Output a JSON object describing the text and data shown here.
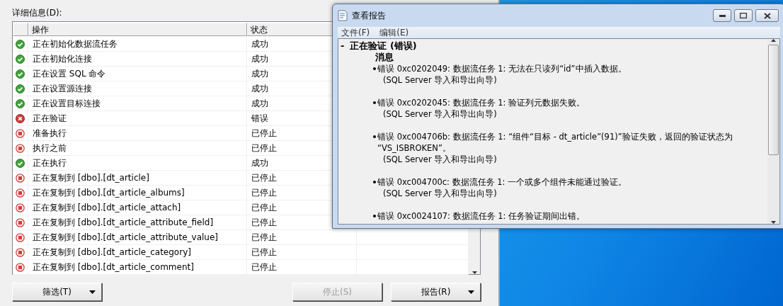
{
  "details_label": "详细信息(D):",
  "table": {
    "columns": [
      "操作",
      "状态"
    ],
    "rows": [
      {
        "kind": "success",
        "operation": "正在初始化数据流任务",
        "status": "成功"
      },
      {
        "kind": "success",
        "operation": "正在初始化连接",
        "status": "成功"
      },
      {
        "kind": "success",
        "operation": "正在设置 SQL 命令",
        "status": "成功"
      },
      {
        "kind": "success",
        "operation": "正在设置源连接",
        "status": "成功"
      },
      {
        "kind": "success",
        "operation": "正在设置目标连接",
        "status": "成功"
      },
      {
        "kind": "error",
        "operation": "正在验证",
        "status": "错误"
      },
      {
        "kind": "stopped",
        "operation": "准备执行",
        "status": "已停止"
      },
      {
        "kind": "stopped",
        "operation": "执行之前",
        "status": "已停止"
      },
      {
        "kind": "success",
        "operation": "正在执行",
        "status": "成功"
      },
      {
        "kind": "stopped",
        "operation": "正在复制到 [dbo].[dt_article]",
        "status": "已停止"
      },
      {
        "kind": "stopped",
        "operation": "正在复制到 [dbo].[dt_article_albums]",
        "status": "已停止"
      },
      {
        "kind": "stopped",
        "operation": "正在复制到 [dbo].[dt_article_attach]",
        "status": "已停止"
      },
      {
        "kind": "stopped",
        "operation": "正在复制到 [dbo].[dt_article_attribute_field]",
        "status": "已停止"
      },
      {
        "kind": "stopped",
        "operation": "正在复制到 [dbo].[dt_article_attribute_value]",
        "status": "已停止"
      },
      {
        "kind": "stopped",
        "operation": "正在复制到 [dbo].[dt_article_category]",
        "status": "已停止"
      },
      {
        "kind": "stopped",
        "operation": "正在复制到 [dbo].[dt_article_comment]",
        "status": "已停止"
      }
    ]
  },
  "buttons": [
    {
      "label": "筛选(T)",
      "dropdown": true,
      "disabled": false
    },
    {
      "label": "停止(S)",
      "dropdown": false,
      "disabled": true
    },
    {
      "label": "报告(R)",
      "dropdown": true,
      "disabled": false
    }
  ],
  "report_window": {
    "title": "查看报告",
    "menu": [
      "文件(F)",
      "编辑(E)"
    ],
    "expander": "-",
    "heading": "正在验证 (错误)",
    "subheading": "消息",
    "messages": [
      {
        "lines": [
          "错误 0xc0202049: 数据流任务 1: 无法在只读列“id”中插入数据。"
        ],
        "source": "(SQL Server 导入和导出向导)"
      },
      {
        "lines": [
          "错误 0xc0202045: 数据流任务 1: 验证列元数据失败。"
        ],
        "source": "(SQL Server 导入和导出向导)"
      },
      {
        "lines": [
          "错误 0xc004706b: 数据流任务 1: “组件“目标 - dt_article”(91)”验证失败，返回的验证状态为",
          "“VS_ISBROKEN”。"
        ],
        "source": "(SQL Server 导入和导出向导)"
      },
      {
        "lines": [
          "错误 0xc004700c: 数据流任务 1: 一个或多个组件未能通过验证。"
        ],
        "source": "(SQL Server 导入和导出向导)"
      },
      {
        "lines": [
          "错误 0xc0024107: 数据流任务 1: 任务验证期间出错。"
        ]
      }
    ]
  }
}
